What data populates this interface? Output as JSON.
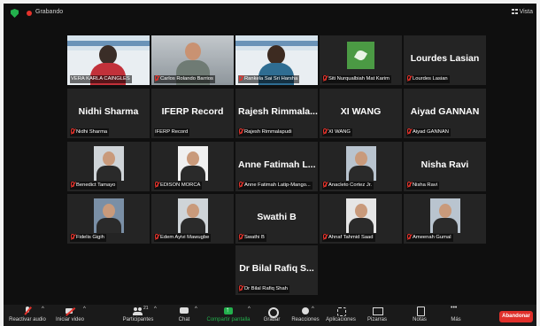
{
  "topbar": {
    "recording_label": "Grabando",
    "view_label": "Vista"
  },
  "participants": [
    {
      "label": "VERA KARLA CAINGLES",
      "big_name": null,
      "video": "banner-female",
      "speaking": true,
      "muted": false
    },
    {
      "label": "Carlos Rolando Barrios",
      "big_name": null,
      "video": "cam-room",
      "speaking": false,
      "muted": true
    },
    {
      "label": "Rankela Sai Sri Harsha",
      "big_name": null,
      "video": "banner-male",
      "speaking": false,
      "muted": true
    },
    {
      "label": "Siti Nurqualbiah Mat Karim",
      "big_name": null,
      "video": "logo",
      "speaking": false,
      "muted": true
    },
    {
      "label": "Lourdes Lasian",
      "big_name": "Lourdes Lasian",
      "video": null,
      "speaking": false,
      "muted": true
    },
    {
      "label": "Nidhi Sharma",
      "big_name": "Nidhi Sharma",
      "video": null,
      "speaking": false,
      "muted": true
    },
    {
      "label": "IFERP Record",
      "big_name": "IFERP Record",
      "video": null,
      "speaking": false,
      "muted": false
    },
    {
      "label": "Rajesh Rimmalapudi",
      "big_name": "Rajesh Rimmala...",
      "video": null,
      "speaking": false,
      "muted": true
    },
    {
      "label": "XI WANG",
      "big_name": "XI WANG",
      "video": null,
      "speaking": false,
      "muted": true
    },
    {
      "label": "Aiyad GANNAN",
      "big_name": "Aiyad GANNAN",
      "video": null,
      "speaking": false,
      "muted": true
    },
    {
      "label": "Benedict Tamayo",
      "big_name": null,
      "video": "portrait",
      "speaking": false,
      "muted": true
    },
    {
      "label": "EDISON MORCA",
      "big_name": null,
      "video": "portrait",
      "speaking": false,
      "muted": true
    },
    {
      "label": "Anne Fatimah Latip-Mango...",
      "big_name": "Anne Fatimah L...",
      "video": null,
      "speaking": false,
      "muted": true
    },
    {
      "label": "Anacleto Cortez Jr.",
      "big_name": null,
      "video": "portrait",
      "speaking": false,
      "muted": true
    },
    {
      "label": "Nisha Ravi",
      "big_name": "Nisha Ravi",
      "video": null,
      "speaking": false,
      "muted": true
    },
    {
      "label": "Fidelis Gigih",
      "big_name": null,
      "video": "portrait",
      "speaking": false,
      "muted": true
    },
    {
      "label": "Edem Ayivi Mawugbe",
      "big_name": null,
      "video": "portrait",
      "speaking": false,
      "muted": true
    },
    {
      "label": "Swathi B",
      "big_name": "Swathi B",
      "video": null,
      "speaking": false,
      "muted": true
    },
    {
      "label": "Ahnaf Tahmid Saad",
      "big_name": null,
      "video": "portrait",
      "speaking": false,
      "muted": true
    },
    {
      "label": "Ameenah Gumal",
      "big_name": null,
      "video": "portrait",
      "speaking": false,
      "muted": true
    },
    {
      "label": "Dr Bilal Rafiq Shah",
      "big_name": "Dr Bilal Rafiq S...",
      "video": null,
      "speaking": false,
      "muted": true
    }
  ],
  "toolbar": {
    "unmute_label": "Reactivar audio",
    "start_video_label": "Iniciar video",
    "participants_label": "Participantes",
    "participants_count": "21",
    "chat_label": "Chat",
    "share_label": "Compartir pantalla",
    "record_label": "Grabar",
    "reactions_label": "Reacciones",
    "apps_label": "Aplicaciones",
    "whiteboard_label": "Pizarras",
    "notes_label": "Notas",
    "more_label": "Más",
    "leave_label": "Abandonar"
  },
  "colors": {
    "accent_green": "#23b14d",
    "leave_red": "#e0302b",
    "speaker_border": "#cfe24a",
    "tile_bg": "#242424"
  }
}
